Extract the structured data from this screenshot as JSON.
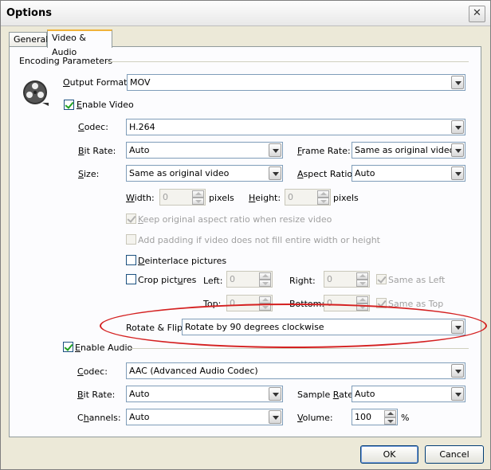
{
  "window": {
    "title": "Options",
    "close_glyph": "✕"
  },
  "tabs": [
    {
      "label": "General",
      "active": false
    },
    {
      "label": "Video & Audio",
      "active": true
    }
  ],
  "encoding": {
    "group_title": "Encoding Parameters",
    "output_format": {
      "label_u": "O",
      "label_rest": "utput Format:",
      "value": "MOV"
    }
  },
  "video": {
    "enable": {
      "label_u": "E",
      "label_rest": "nable Video",
      "checked": true
    },
    "codec": {
      "label_u": "C",
      "label_rest": "odec:",
      "value": "H.264"
    },
    "bit_rate": {
      "label_u": "B",
      "label_rest": "it Rate:",
      "value": "Auto"
    },
    "frame_rate": {
      "label_u": "F",
      "label_rest": "rame Rate:",
      "value": "Same as original video"
    },
    "size": {
      "label_u": "S",
      "label_rest": "ize:",
      "value": "Same as original video"
    },
    "aspect_ratio": {
      "label_u": "A",
      "label_rest": "spect Ratio:",
      "value": "Auto"
    },
    "width": {
      "label_u": "W",
      "label_rest": "idth:",
      "value": "0",
      "unit": "pixels"
    },
    "height": {
      "label_u": "H",
      "label_rest": "eight:",
      "value": "0",
      "unit": "pixels"
    },
    "keep_aspect": {
      "label_u": "K",
      "label_rest": "eep original aspect ratio when resize video",
      "checked": true
    },
    "add_padding": {
      "label": "Add padding if video does not fill entire width or height",
      "checked": false
    },
    "deinterlace": {
      "label_u": "D",
      "label_rest": "einterlace pictures",
      "checked": false
    },
    "crop": {
      "label_pre": "Crop pict",
      "label_u": "u",
      "label_rest": "res",
      "checked": false,
      "left": {
        "label": "Left:",
        "value": "0"
      },
      "right": {
        "label": "Right:",
        "value": "0"
      },
      "top": {
        "label": "Top:",
        "value": "0"
      },
      "bottom": {
        "label": "Bottom:",
        "value": "0"
      },
      "same_as_left": {
        "label": "Same as Left",
        "checked": true
      },
      "same_as_top": {
        "label": "Same as Top",
        "checked": true
      }
    },
    "rotate": {
      "label": "Rotate & Flip:",
      "value": "Rotate by 90 degrees clockwise",
      "highlight_color": "#d42020"
    }
  },
  "audio": {
    "enable": {
      "label_u": "E",
      "label_rest": "nable Audio",
      "checked": true
    },
    "codec": {
      "label_u": "C",
      "label_rest": "odec:",
      "value": "AAC (Advanced Audio Codec)"
    },
    "bit_rate": {
      "label_u": "B",
      "label_rest": "it Rate:",
      "value": "Auto"
    },
    "sample_rate": {
      "label_pre": "Sample ",
      "label_u": "R",
      "label_rest": "ate:",
      "value": "Auto"
    },
    "channels": {
      "label_pre": "C",
      "label_u": "h",
      "label_rest": "annels:",
      "value": "Auto"
    },
    "volume": {
      "label_u": "V",
      "label_rest": "olume:",
      "value": "100",
      "unit": "%"
    }
  },
  "buttons": {
    "ok": "OK",
    "cancel": "Cancel"
  }
}
